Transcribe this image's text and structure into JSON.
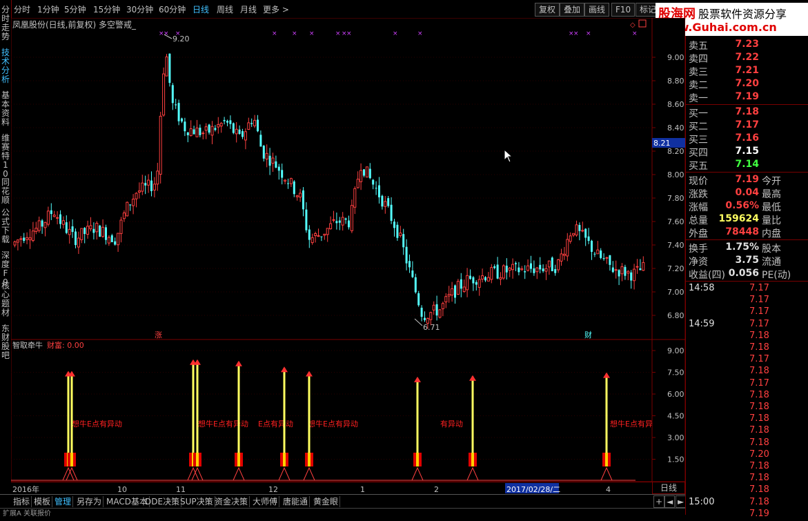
{
  "toolbar": {
    "periods": [
      "分时",
      "1分钟",
      "5分钟",
      "15分钟",
      "30分钟",
      "60分钟",
      "日线",
      "周线",
      "月线",
      "更多"
    ],
    "active_period": "日线",
    "right_buttons": [
      "复权",
      "叠加",
      "画线",
      "F10",
      "标记"
    ]
  },
  "logo": {
    "brand": "股海网",
    "slogan": "股票软件资源分享",
    "url": "www.Guhai.com.cn"
  },
  "left_tabs": [
    "分时走势",
    "技术分析",
    "基本资料",
    "维赛特10",
    "同花顺",
    "公式下载",
    "深度F9",
    "核心题材",
    "东财股吧"
  ],
  "active_left_tab": "技术分析",
  "main_chart": {
    "title": "凤凰股份(日线,前复权) 多空警戒_",
    "high_label": "9.20",
    "low_label": "6.71",
    "axis_ticks": [
      "9.00",
      "8.80",
      "8.60",
      "8.40",
      "8.20",
      "8.00",
      "7.80",
      "7.60",
      "7.40",
      "7.20",
      "7.00",
      "6.80"
    ],
    "current_price_tag": "8.21",
    "event_labels": [
      "涨",
      "财"
    ]
  },
  "sub_chart": {
    "title": "智取牵牛",
    "value_label": "财富: 0.00",
    "axis_ticks": [
      "9.00",
      "7.50",
      "6.00",
      "4.50",
      "3.00",
      "1.50"
    ],
    "overlay_texts": [
      "想牛E点有异动",
      "想牛E点有异动",
      "E点有异动",
      "想牛E点有异动",
      "有异动",
      "想牛E点有异"
    ]
  },
  "date_axis": {
    "labels": [
      "2016年",
      "10",
      "11",
      "12",
      "1",
      "2",
      "2017/02/28/二",
      "4"
    ],
    "highlight": "2017/02/28/二",
    "period_tag": "日线"
  },
  "quote": {
    "sell": [
      {
        "label": "卖五",
        "price": "7.23"
      },
      {
        "label": "卖四",
        "price": "7.22"
      },
      {
        "label": "卖三",
        "price": "7.21"
      },
      {
        "label": "卖二",
        "price": "7.20"
      },
      {
        "label": "卖一",
        "price": "7.19"
      }
    ],
    "buy": [
      {
        "label": "买一",
        "price": "7.18",
        "color": "#ff4040"
      },
      {
        "label": "买二",
        "price": "7.17",
        "color": "#ff4040"
      },
      {
        "label": "买三",
        "price": "7.16",
        "color": "#ff4040"
      },
      {
        "label": "买四",
        "price": "7.15",
        "color": "#ffffff"
      },
      {
        "label": "买五",
        "price": "7.14",
        "color": "#40ff40"
      }
    ],
    "stats": [
      {
        "label": "现价",
        "value": "7.19",
        "extra": "今开",
        "color": "#ff4040"
      },
      {
        "label": "涨跌",
        "value": "0.04",
        "extra": "最高",
        "color": "#ff4040"
      },
      {
        "label": "涨幅",
        "value": "0.56%",
        "extra": "最低",
        "color": "#ff4040"
      },
      {
        "label": "总量",
        "value": "159624",
        "extra": "量比",
        "color": "#ffff60"
      },
      {
        "label": "外盘",
        "value": "78448",
        "extra": "内盘",
        "color": "#ff4040"
      }
    ],
    "fundamentals": [
      {
        "label": "换手",
        "value": "1.75%",
        "extra": "股本"
      },
      {
        "label": "净资",
        "value": "3.75",
        "extra": "流通"
      },
      {
        "label": "收益(四)",
        "value": "0.056",
        "extra": "PE(动)"
      }
    ],
    "ticks": [
      {
        "time": "14:58",
        "price": "7.17"
      },
      {
        "time": "",
        "price": "7.17"
      },
      {
        "time": "",
        "price": "7.17"
      },
      {
        "time": "14:59",
        "price": "7.17"
      },
      {
        "time": "",
        "price": "7.18"
      },
      {
        "time": "",
        "price": "7.18"
      },
      {
        "time": "",
        "price": "7.17"
      },
      {
        "time": "",
        "price": "7.18"
      },
      {
        "time": "",
        "price": "7.17"
      },
      {
        "time": "",
        "price": "7.18"
      },
      {
        "time": "",
        "price": "7.18"
      },
      {
        "time": "",
        "price": "7.18"
      },
      {
        "time": "",
        "price": "7.18"
      },
      {
        "time": "",
        "price": "7.18"
      },
      {
        "time": "",
        "price": "7.20"
      },
      {
        "time": "",
        "price": "7.18"
      },
      {
        "time": "",
        "price": "7.18"
      },
      {
        "time": "",
        "price": "7.18"
      },
      {
        "time": "15:00",
        "price": "7.18"
      },
      {
        "time": "",
        "price": "7.19"
      }
    ]
  },
  "bottom_tabs": [
    "指标",
    "模板",
    "管理",
    "另存为",
    "MACD基本",
    "DDE决策",
    "SUP决策",
    "资金决策",
    "大师傅",
    "唐能通",
    "黄金眼"
  ],
  "active_bottom_tab": "管理",
  "status_text": "扩展A 关联报价",
  "colors": {
    "up": "#ff4040",
    "down": "#54ffff",
    "frame": "#7a0000",
    "accent": "#40c0ff"
  }
}
